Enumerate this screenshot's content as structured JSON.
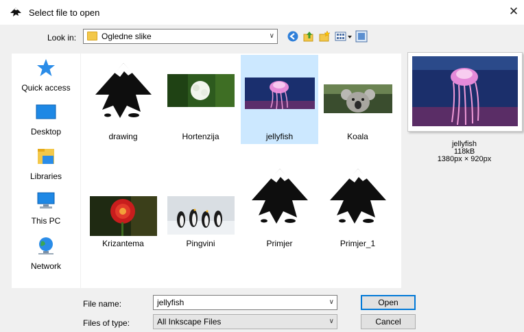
{
  "window": {
    "title": "Select file to open",
    "close_symbol": "✕"
  },
  "lookin": {
    "label": "Look in:",
    "value": "Ogledne slike"
  },
  "places": [
    {
      "label": "Quick access",
      "icon": "quick-access-star-icon"
    },
    {
      "label": "Desktop",
      "icon": "desktop-icon"
    },
    {
      "label": "Libraries",
      "icon": "libraries-icon"
    },
    {
      "label": "This PC",
      "icon": "this-pc-icon"
    },
    {
      "label": "Network",
      "icon": "network-icon"
    }
  ],
  "files": [
    {
      "name": "drawing",
      "type": "inkscape-logo"
    },
    {
      "name": "Hortenzija",
      "type": "photo-hydrangea"
    },
    {
      "name": "jellyfish",
      "type": "photo-jellyfish",
      "selected": true
    },
    {
      "name": "Koala",
      "type": "photo-koala"
    },
    {
      "name": "Krizantema",
      "type": "photo-chrysanthemum"
    },
    {
      "name": "Pingvini",
      "type": "photo-penguins"
    },
    {
      "name": "Primjer",
      "type": "inkscape-logo"
    },
    {
      "name": "Primjer_1",
      "type": "inkscape-logo"
    }
  ],
  "preview": {
    "name": "jellyfish",
    "size": "118kB",
    "dimensions": "1380px × 920px"
  },
  "filename": {
    "label": "File name:",
    "value": "jellyfish"
  },
  "filetype": {
    "label": "Files of type:",
    "value": "All Inkscape Files"
  },
  "buttons": {
    "open": "Open",
    "cancel": "Cancel"
  },
  "colors": {
    "selection": "#cce8ff",
    "accent": "#0078d7"
  }
}
